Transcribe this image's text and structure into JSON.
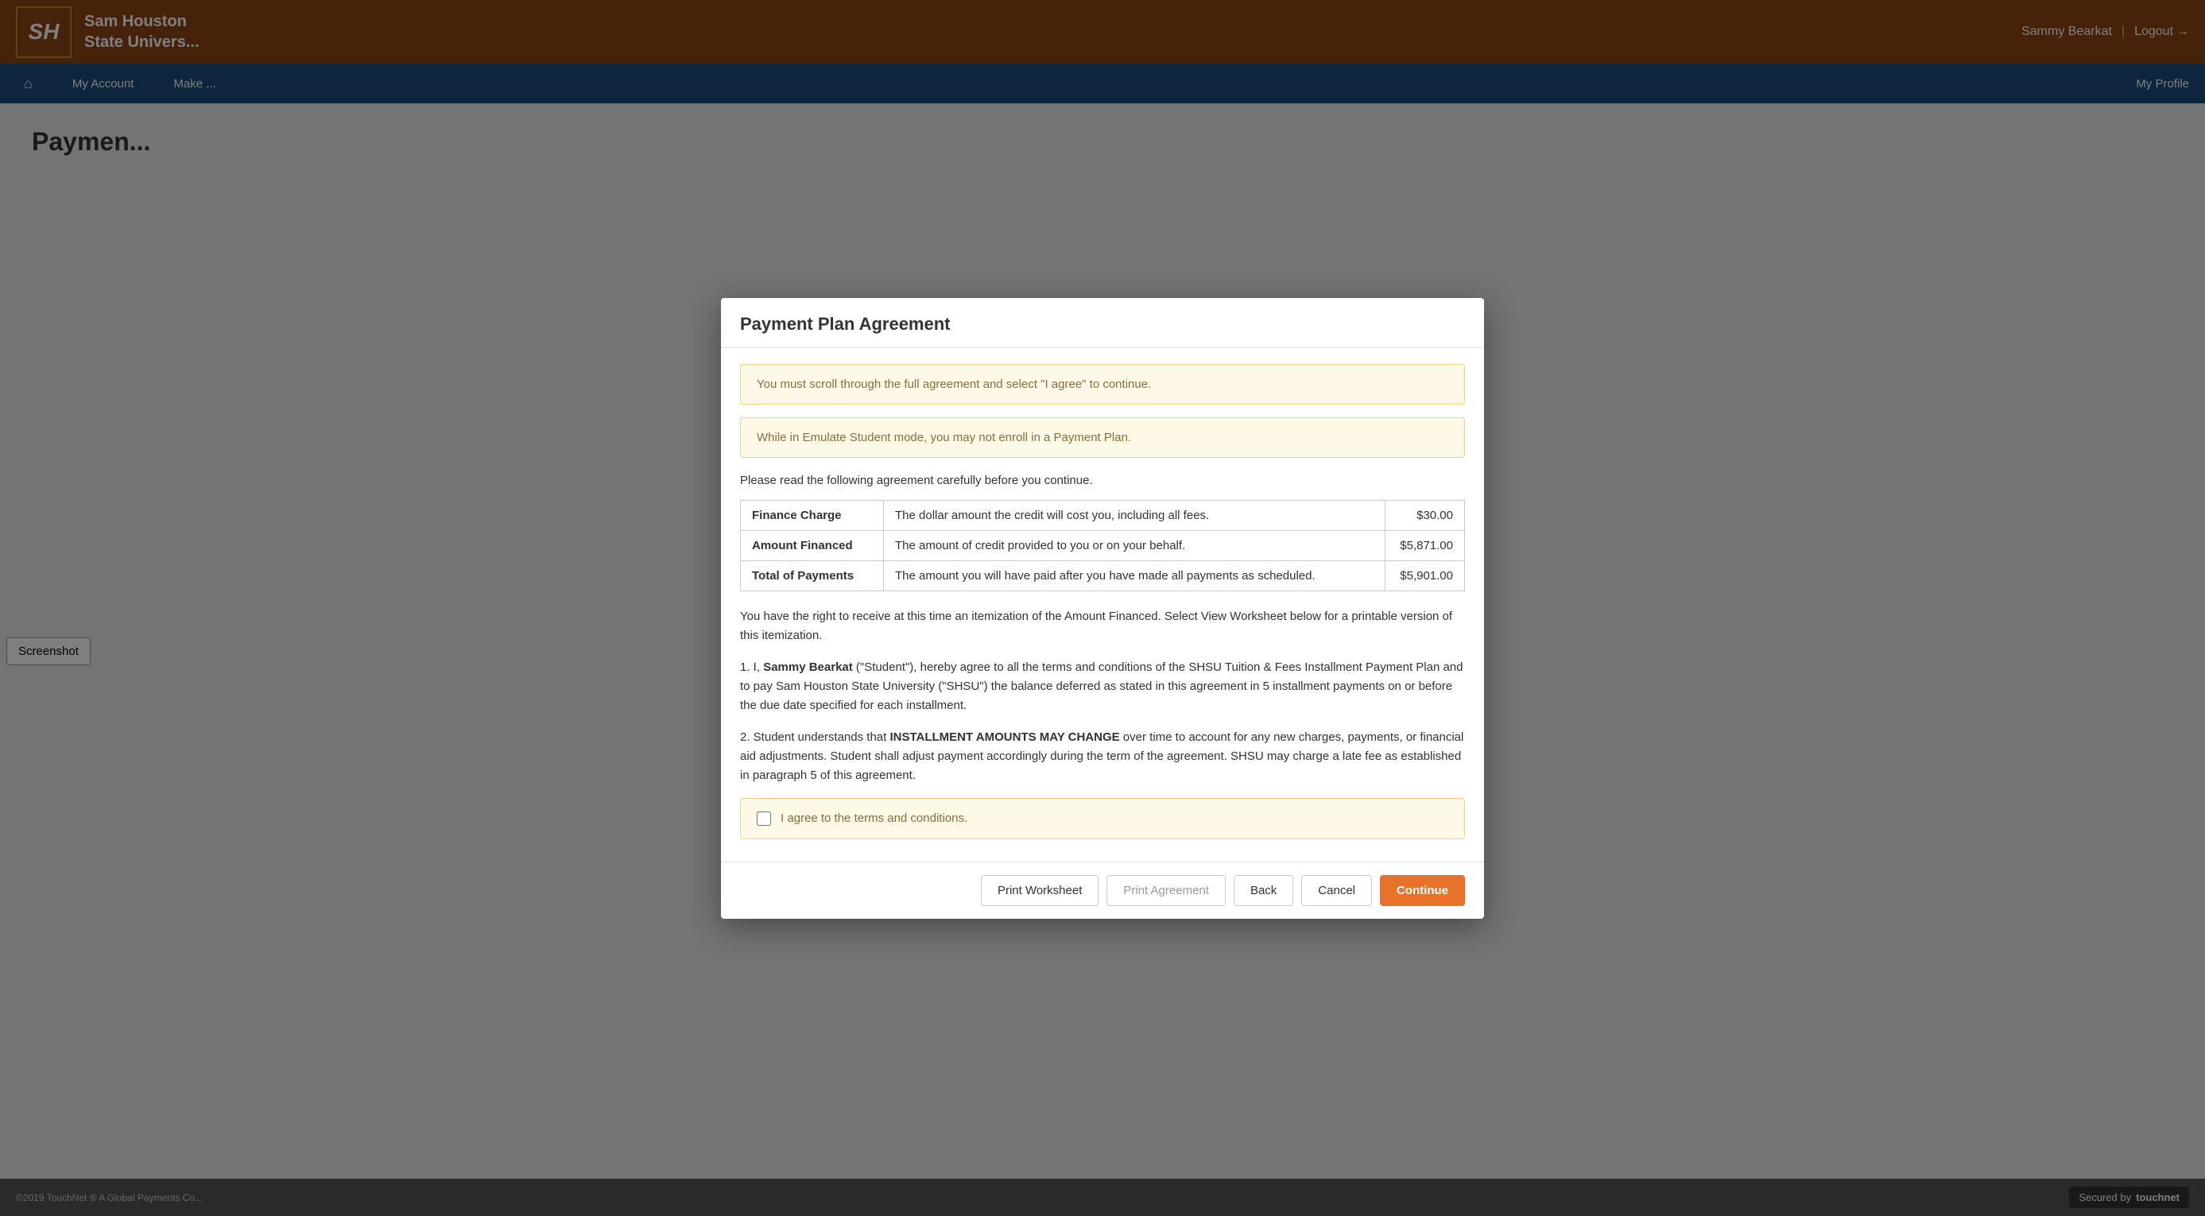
{
  "header": {
    "logo_initials": "SH",
    "university_line1": "Sam Houston",
    "university_line2": "State Univers...",
    "user_name": "Sammy Bearkat",
    "logout_label": "Logout"
  },
  "nav": {
    "home_icon": "⌂",
    "items": [
      {
        "label": "My Account"
      },
      {
        "label": "Make ..."
      }
    ],
    "my_profile": "My Profile"
  },
  "page": {
    "title": "Paymen..."
  },
  "screenshot_btn": "Screenshot",
  "footer": {
    "copyright": "©2019 TouchNet ® A Global Payments Co...",
    "secured_label": "Secured by",
    "brand": "touchnet"
  },
  "modal": {
    "title": "Payment Plan Agreement",
    "alert1": "You must scroll through the full agreement and select \"I agree\" to continue.",
    "alert2": "While in Emulate Student mode, you may not enroll in a Payment Plan.",
    "intro": "Please read the following agreement carefully before you continue.",
    "table": {
      "rows": [
        {
          "label": "Finance Charge",
          "description": "The dollar amount the credit will cost you, including all fees.",
          "amount": "$30.00"
        },
        {
          "label": "Amount Financed",
          "description": "The amount of credit provided to you or on your behalf.",
          "amount": "$5,871.00"
        },
        {
          "label": "Total of Payments",
          "description": "The amount you will have paid after you have made all payments as scheduled.",
          "amount": "$5,901.00"
        }
      ]
    },
    "body_para1": "You have the right to receive at this time an itemization of the Amount Financed. Select View Worksheet below for a printable version of this itemization.",
    "body_para2_prefix": "1. I, ",
    "student_name": "Sammy Bearkat",
    "body_para2_suffix": "        (\"Student\"), hereby agree to all the terms and conditions of the SHSU Tuition & Fees Installment Payment Plan and to pay Sam Houston State University (\"SHSU\") the balance deferred as stated in this agreement in 5 installment payments on or before the due date specified for each installment.",
    "body_para3": "2. Student understands that INSTALLMENT AMOUNTS MAY CHANGE over time to account for any new charges, payments, or financial aid adjustments. Student shall adjust payment accordingly during the term of the agreement. SHSU may charge a late fee as established in paragraph 5 of this agreement.",
    "agree_label": "I agree to the terms and conditions.",
    "buttons": {
      "print_worksheet": "Print Worksheet",
      "print_agreement": "Print Agreement",
      "back": "Back",
      "cancel": "Cancel",
      "continue": "Continue"
    }
  }
}
